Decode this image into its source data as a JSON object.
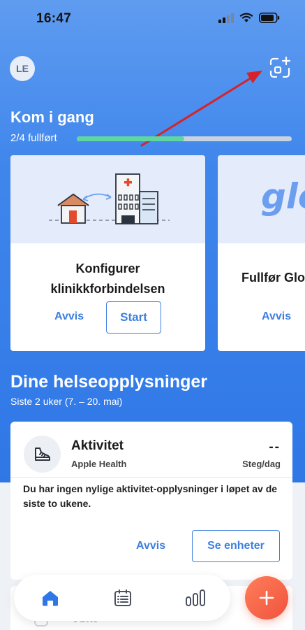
{
  "status_bar": {
    "time": "16:47"
  },
  "header": {
    "avatar_initials": "LE",
    "scan_icon": "scan-add-icon"
  },
  "getting_started": {
    "title": "Kom i gang",
    "progress_text": "2/4 fullført",
    "progress_fraction": 0.5,
    "cards": [
      {
        "title_line1": "Konfigurer",
        "title_line2": "klinikkforbindelsen",
        "dismiss_label": "Avvis",
        "start_label": "Start"
      },
      {
        "title": "Fullfør Glo",
        "hero_text": "glo",
        "dismiss_label": "Avvis"
      }
    ]
  },
  "health": {
    "title": "Dine helseopplysninger",
    "subtitle": "Siste 2 uker (7. – 20. mai)",
    "activity": {
      "title": "Aktivitet",
      "source": "Apple Health",
      "value": "--",
      "unit": "Steg/dag",
      "message": "Du har ingen nylige aktivitet-opplysninger i løpet av de siste to ukene.",
      "dismiss_label": "Avvis",
      "devices_label": "Se enheter"
    },
    "peek": {
      "label": "Vekt"
    }
  },
  "colors": {
    "accent": "#3d7fe0",
    "progress": "#5fd6a1",
    "fab": "#f0533d",
    "arrow": "#d6232a"
  },
  "nav": {
    "items": [
      "home-icon",
      "journal-icon",
      "stats-icon"
    ],
    "fab_icon": "plus-icon"
  }
}
